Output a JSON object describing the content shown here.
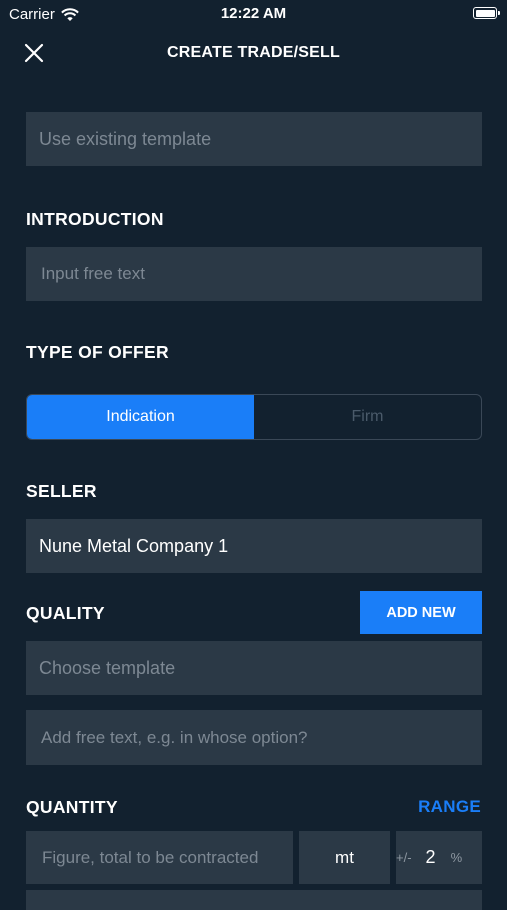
{
  "status_bar": {
    "carrier": "Carrier",
    "time": "12:22 AM"
  },
  "nav": {
    "title": "CREATE TRADE/SELL",
    "close_icon": "close-icon"
  },
  "template": {
    "placeholder": "Use existing template"
  },
  "introduction": {
    "label": "INTRODUCTION",
    "placeholder": "Input free text"
  },
  "type_of_offer": {
    "label": "TYPE OF OFFER",
    "options": [
      "Indication",
      "Firm"
    ],
    "selected": "Indication"
  },
  "seller": {
    "label": "SELLER",
    "value": "Nune Metal Company 1"
  },
  "quality": {
    "label": "QUALITY",
    "add_new_label": "ADD NEW",
    "template_placeholder": "Choose template",
    "free_text_placeholder": "Add free text, e.g. in whose option?"
  },
  "quantity": {
    "label": "QUANTITY",
    "range_label": "RANGE",
    "figure_placeholder": "Figure, total to be contracted",
    "unit": "mt",
    "tolerance_prefix": "+/-",
    "tolerance_value": "2",
    "tolerance_suffix": "%"
  },
  "colors": {
    "background": "#12212f",
    "field": "#2b3946",
    "accent": "#1a7ef8"
  }
}
